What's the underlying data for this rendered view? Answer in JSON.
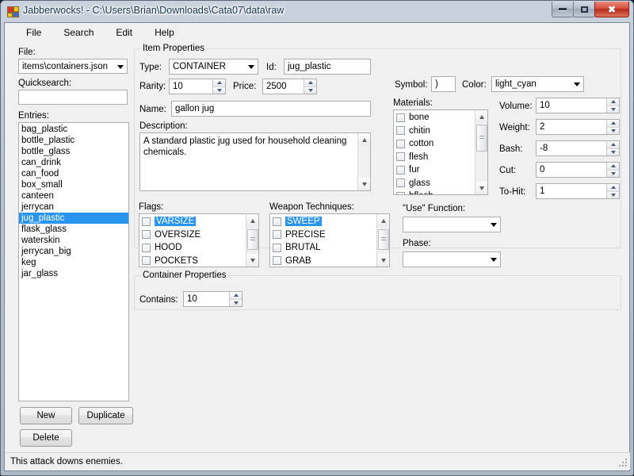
{
  "window": {
    "title": "Jabberwocks! - C:\\Users\\Brian\\Downloads\\Cata07\\data\\raw",
    "minimize_label": "–",
    "maximize_label": "□",
    "close_label": "x"
  },
  "menu": {
    "items": [
      {
        "label": "File"
      },
      {
        "label": "Search"
      },
      {
        "label": "Edit"
      },
      {
        "label": "Help"
      }
    ]
  },
  "sidebar": {
    "file_label": "File:",
    "file_value": "items\\containers.json",
    "quicksearch_label": "Quicksearch:",
    "quicksearch_value": "",
    "quicksearch_placeholder": "",
    "entries_label": "Entries:",
    "entries": [
      "bag_plastic",
      "bottle_plastic",
      "bottle_glass",
      "can_drink",
      "can_food",
      "box_small",
      "canteen",
      "jerrycan",
      "jug_plastic",
      "flask_glass",
      "waterskin",
      "jerrycan_big",
      "keg",
      "jar_glass"
    ],
    "selected_entry": "jug_plastic",
    "new_label": "New",
    "duplicate_label": "Duplicate",
    "delete_label": "Delete"
  },
  "item_properties": {
    "group_title": "Item Properties",
    "type_label": "Type:",
    "type_value": "CONTAINER",
    "id_label": "Id:",
    "id_value": "jug_plastic",
    "rarity_label": "Rarity:",
    "rarity_value": "10",
    "price_label": "Price:",
    "price_value": "2500",
    "name_label": "Name:",
    "name_value": "gallon jug",
    "description_label": "Description:",
    "description_value": "A standard plastic jug used for household cleaning chemicals.",
    "symbol_label": "Symbol:",
    "symbol_value": ")",
    "color_label": "Color:",
    "color_value": "light_cyan",
    "materials_label": "Materials:",
    "materials": [
      {
        "name": "bone",
        "checked": false
      },
      {
        "name": "chitin",
        "checked": false
      },
      {
        "name": "cotton",
        "checked": false
      },
      {
        "name": "flesh",
        "checked": false
      },
      {
        "name": "fur",
        "checked": false
      },
      {
        "name": "glass",
        "checked": false
      },
      {
        "name": "hflesh",
        "checked": false
      }
    ],
    "volume_label": "Volume:",
    "volume_value": "10",
    "weight_label": "Weight:",
    "weight_value": "2",
    "bash_label": "Bash:",
    "bash_value": "-8",
    "cut_label": "Cut:",
    "cut_value": "0",
    "tohit_label": "To-Hit:",
    "tohit_value": "1"
  },
  "flags": {
    "label": "Flags:",
    "items": [
      {
        "name": "VARSIZE",
        "checked": false,
        "selected": true
      },
      {
        "name": "OVERSIZE",
        "checked": false,
        "selected": false
      },
      {
        "name": "HOOD",
        "checked": false,
        "selected": false
      },
      {
        "name": "POCKETS",
        "checked": false,
        "selected": false
      }
    ]
  },
  "techniques": {
    "label": "Weapon Techniques:",
    "items": [
      {
        "name": "SWEEP",
        "checked": false,
        "selected": true
      },
      {
        "name": "PRECISE",
        "checked": false,
        "selected": false
      },
      {
        "name": "BRUTAL",
        "checked": false,
        "selected": false
      },
      {
        "name": "GRAB",
        "checked": false,
        "selected": false
      }
    ]
  },
  "use_function": {
    "label": "\"Use\" Function:",
    "value": "",
    "phase_label": "Phase:",
    "phase_value": ""
  },
  "container_properties": {
    "group_title": "Container Properties",
    "contains_label": "Contains:",
    "contains_value": "10"
  },
  "statusbar": {
    "text": "This attack downs enemies."
  },
  "colors": {
    "selection_blue": "#2a95f0",
    "window_bg": "#f0f0f0",
    "field_bg": "#ffffff",
    "border": "#abadb3"
  }
}
